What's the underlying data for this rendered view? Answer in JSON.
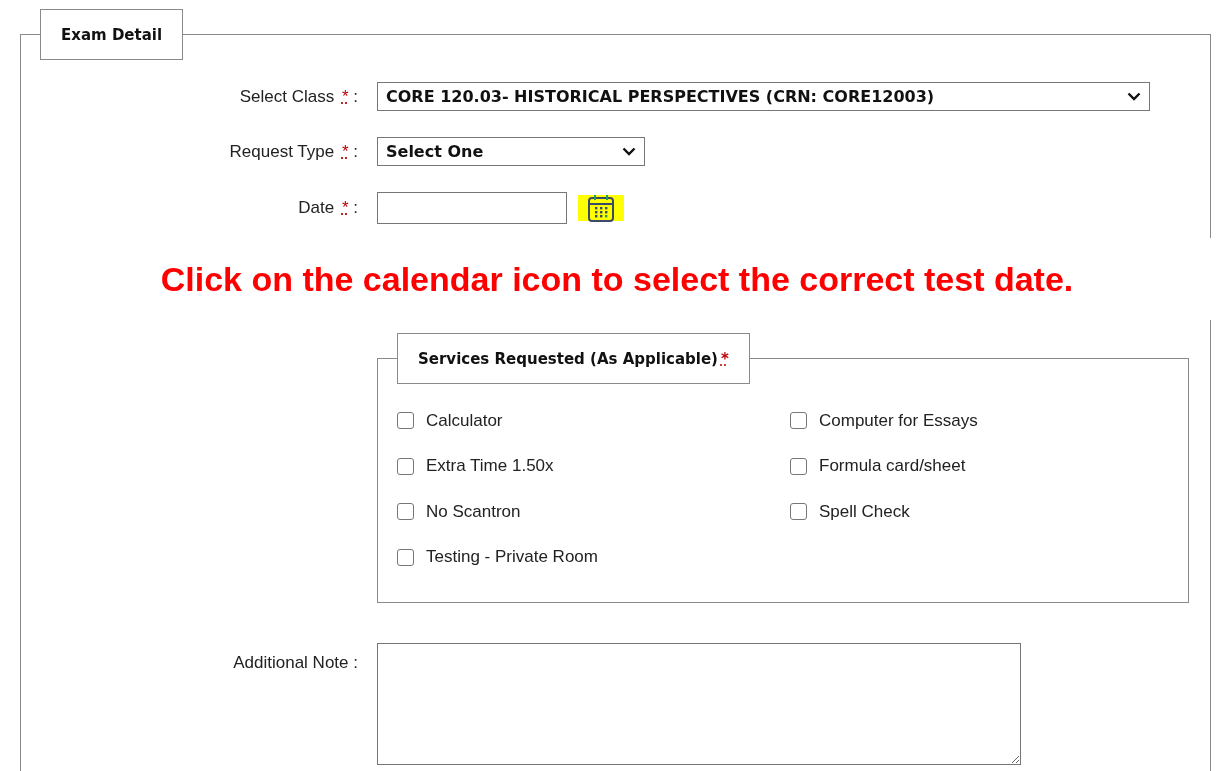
{
  "fieldset": {
    "legend": "Exam Detail"
  },
  "fields": [
    {
      "kind": "dropdown",
      "label": "Select Class",
      "required_mark": "*",
      "colon": ":",
      "value": "CORE 120.03- HISTORICAL PERSPECTIVES (CRN: CORE12003)"
    },
    {
      "kind": "dropdown",
      "label": "Request Type",
      "required_mark": "*",
      "colon": ":",
      "value": "Select One"
    },
    {
      "kind": "date",
      "label": "Date",
      "required_mark": "*",
      "colon": ":",
      "calendar_highlighted": true
    }
  ],
  "annotation": {
    "text": "Click on the calendar icon to select the correct test date."
  },
  "services": {
    "legend": "Services Requested (As Applicable)",
    "required_mark": "*",
    "options": [
      {
        "label": "Calculator",
        "checked": false
      },
      {
        "label": "Extra Time 1.50x",
        "checked": false
      },
      {
        "label": "No Scantron",
        "checked": false
      },
      {
        "label": "Testing - Private Room",
        "checked": false
      },
      {
        "label": "Computer for Essays",
        "checked": false
      },
      {
        "label": "Formula card/sheet",
        "checked": false
      },
      {
        "label": "Spell Check",
        "checked": false
      }
    ]
  },
  "note": {
    "label": "Additional Note",
    "colon": ":"
  }
}
